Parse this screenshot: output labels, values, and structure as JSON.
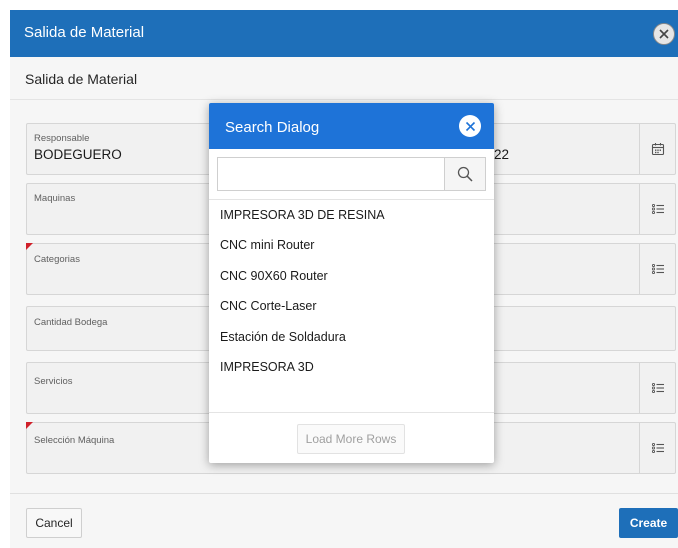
{
  "dialog": {
    "title": "Salida de Material",
    "region_title": "Salida de Material",
    "fields": [
      {
        "label": "Responsable",
        "value": "BODEGUERO",
        "button_icon": "calendar-icon",
        "required": false
      },
      {
        "label": "Maquinas",
        "value": "",
        "button_icon": "list-icon",
        "required": false
      },
      {
        "label": "Categorias",
        "value": "",
        "button_icon": "list-icon",
        "required": true
      },
      {
        "label": "Cantidad Bodega",
        "value": "",
        "button_icon": "",
        "required": false
      },
      {
        "label": "Servicios",
        "value": "",
        "button_icon": "list-icon",
        "required": false
      },
      {
        "label": "Selección Máquina",
        "value": "",
        "button_icon": "list-icon",
        "required": true
      }
    ],
    "partial_date_value": "22",
    "cancel_label": "Cancel",
    "create_label": "Create"
  },
  "search_dialog": {
    "title": "Search Dialog",
    "search_value": "",
    "results": [
      "IMPRESORA 3D DE RESINA",
      "CNC mini Router",
      "CNC 90X60 Router",
      "CNC Corte-Laser",
      "Estación de Soldadura",
      "IMPRESORA 3D"
    ],
    "load_more_label": "Load More Rows"
  },
  "colors": {
    "header_blue": "#1e6fb9",
    "popup_blue": "#1e73d8",
    "required_red": "#d0202a"
  }
}
